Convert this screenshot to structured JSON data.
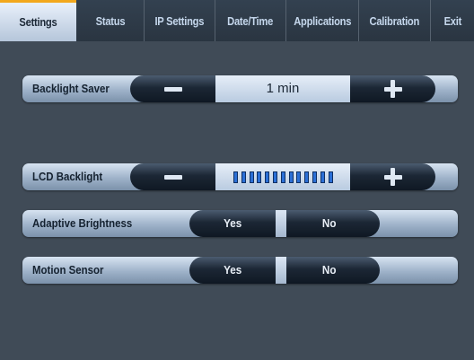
{
  "tabs": [
    {
      "label": "Settings",
      "active": true
    },
    {
      "label": "Status",
      "active": false
    },
    {
      "label": "IP Settings",
      "active": false
    },
    {
      "label": "Date/Time",
      "active": false
    },
    {
      "label": "Applications",
      "active": false
    },
    {
      "label": "Calibration",
      "active": false
    },
    {
      "label": "Exit",
      "active": false
    }
  ],
  "backlight_saver": {
    "label": "Backlight Saver",
    "value": "1 min"
  },
  "lcd_backlight": {
    "label": "LCD Backlight",
    "level_fraction": 1.0
  },
  "adaptive_brightness": {
    "label": "Adaptive Brightness",
    "yes_label": "Yes",
    "no_label": "No"
  },
  "motion_sensor": {
    "label": "Motion Sensor",
    "yes_label": "Yes",
    "no_label": "No"
  },
  "colors": {
    "active_tab_accent": "#f2a81d",
    "level_segment": "#2b6fd6",
    "background": "#404b57"
  },
  "icons": {
    "decrease": "minus-icon",
    "increase": "plus-icon"
  }
}
